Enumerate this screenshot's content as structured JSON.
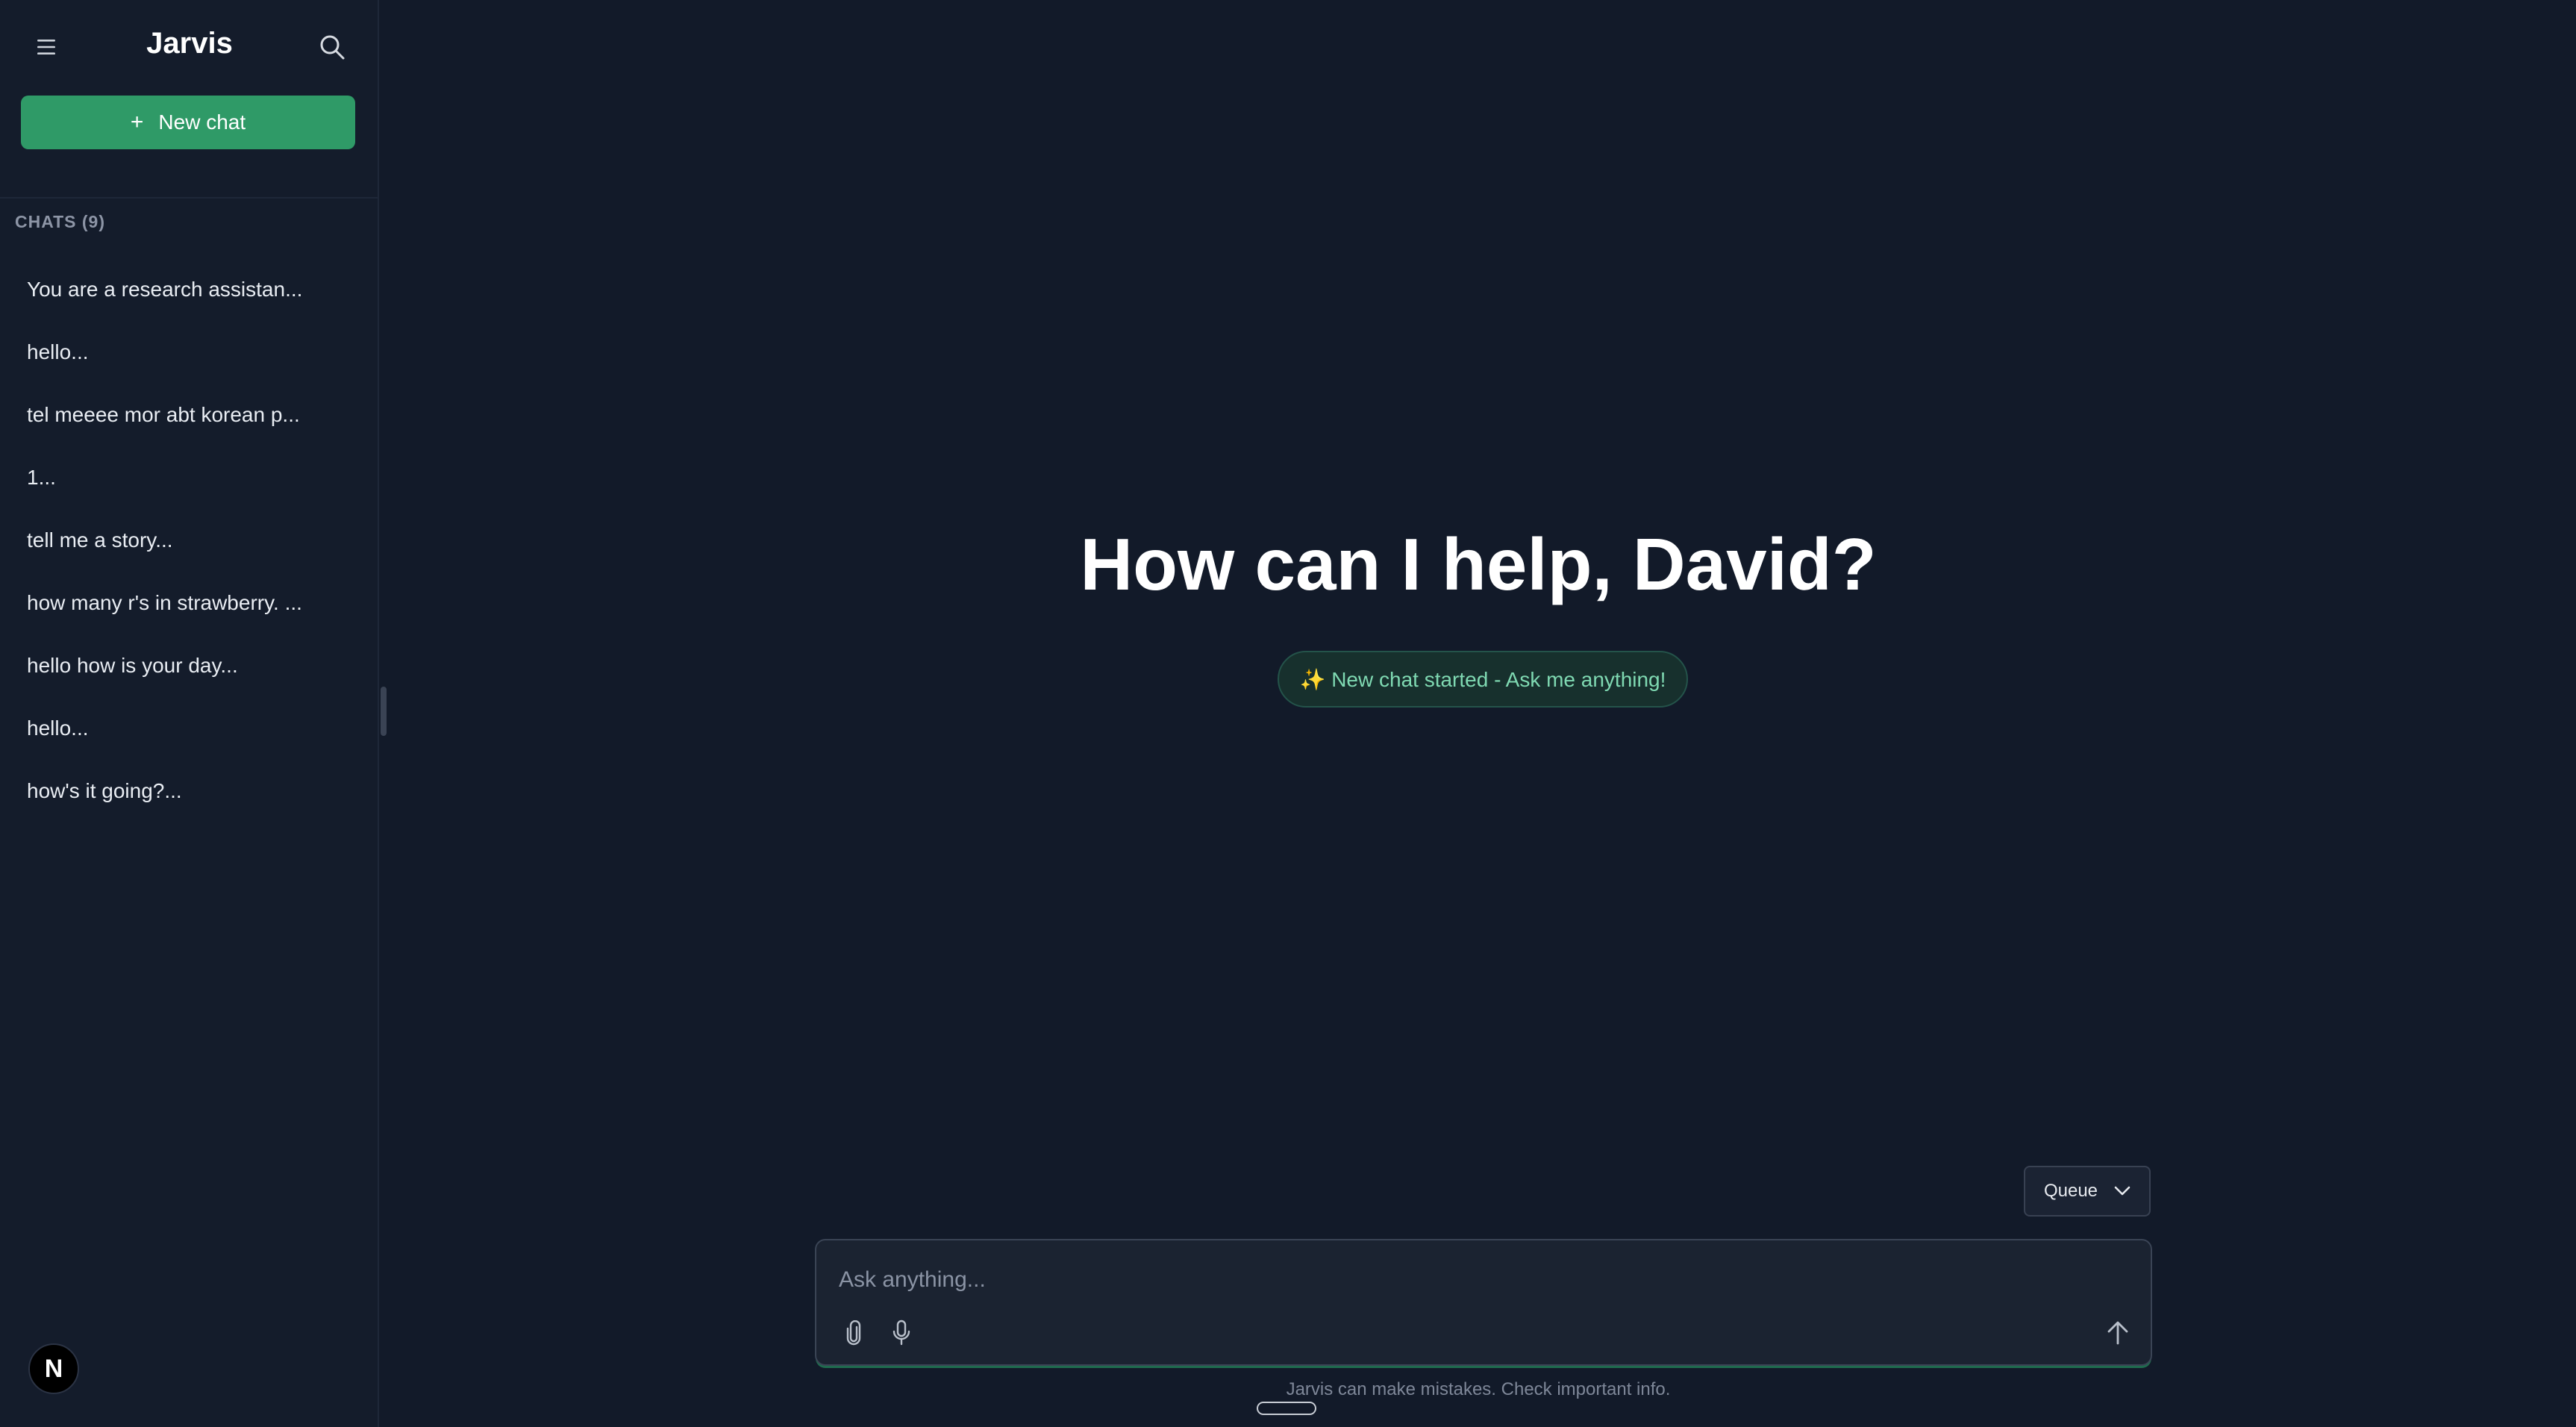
{
  "app": {
    "title": "Jarvis",
    "accent_color": "#2f9a67",
    "background_color": "#121a29"
  },
  "sidebar": {
    "menu_icon": "hamburger-menu-icon",
    "search_icon": "search-icon",
    "new_chat_label": "New chat",
    "new_chat_icon": "plus-icon",
    "chats_header": "CHATS (9)",
    "chats": [
      {
        "label": "You are a research assistan..."
      },
      {
        "label": "hello..."
      },
      {
        "label": "tel meeee mor abt korean p..."
      },
      {
        "label": "1..."
      },
      {
        "label": "tell me a story..."
      },
      {
        "label": "how many r's in strawberry. ..."
      },
      {
        "label": "hello how is your day..."
      },
      {
        "label": "hello..."
      },
      {
        "label": "how's it going?..."
      }
    ],
    "avatar_letter": "N"
  },
  "main": {
    "greeting": "How can I help, David?",
    "status_message": "✨ New chat started - Ask me anything!",
    "queue_label": "Queue",
    "composer": {
      "placeholder": "Ask anything...",
      "attach_icon": "paperclip-icon",
      "mic_icon": "microphone-icon",
      "send_icon": "arrow-up-icon"
    },
    "disclaimer": "Jarvis can make mistakes. Check important info."
  }
}
